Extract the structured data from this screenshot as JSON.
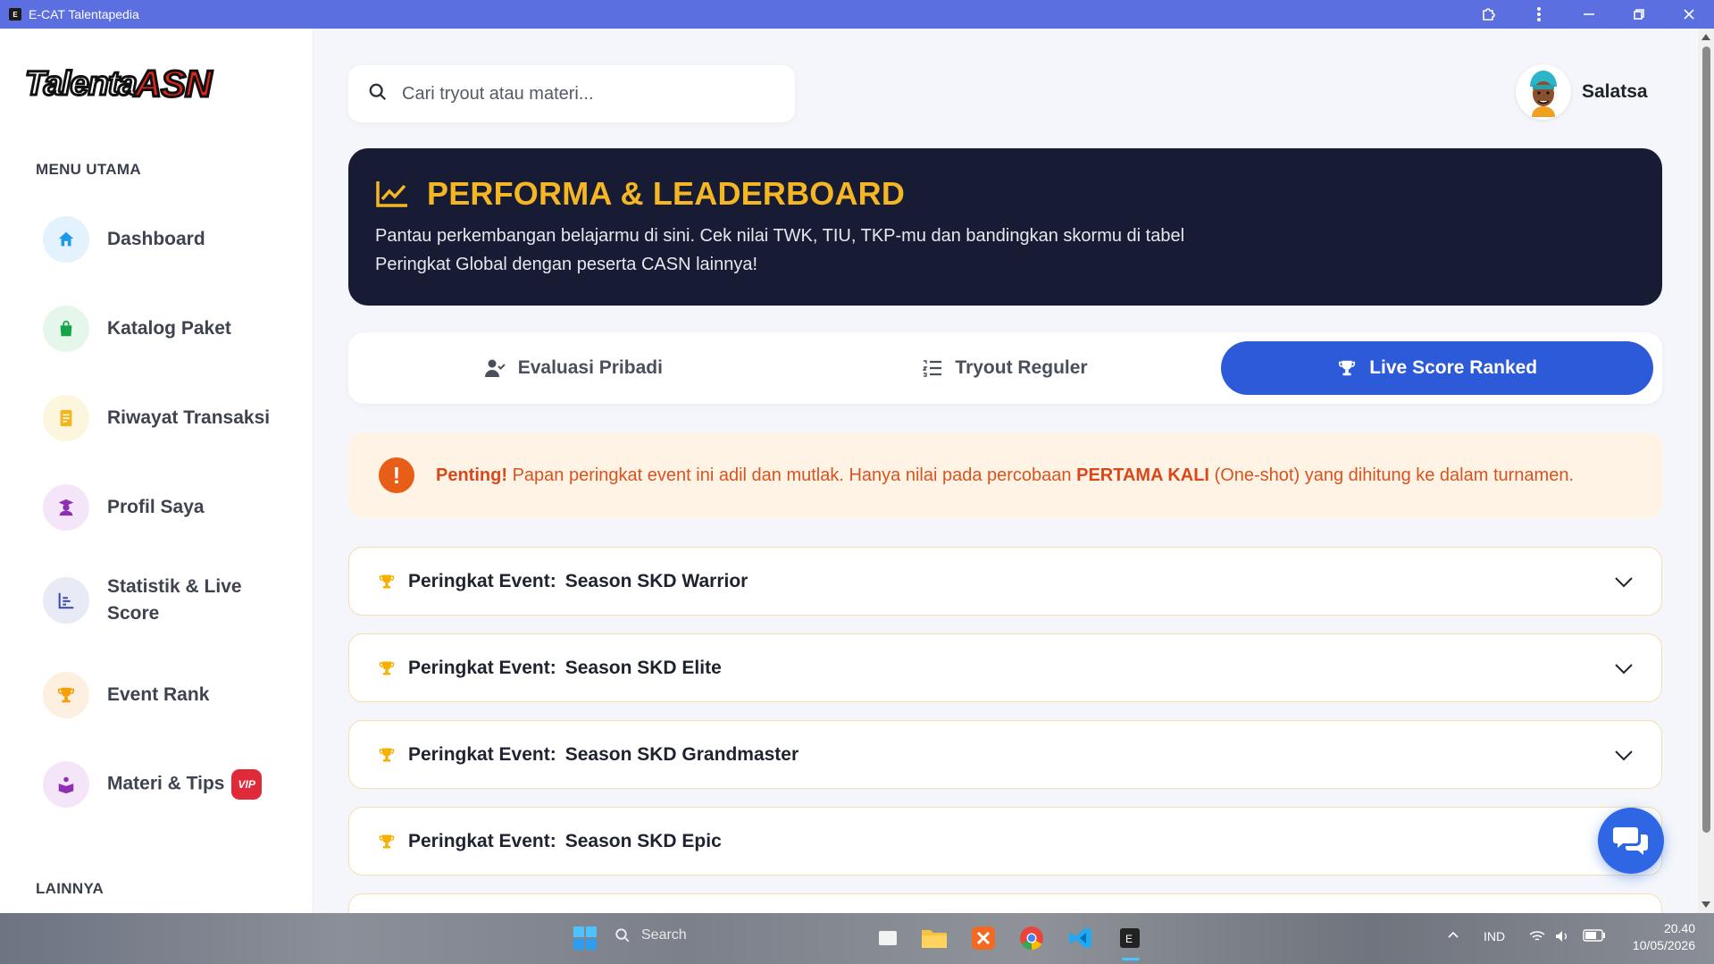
{
  "window": {
    "title": "E-CAT Talentapedia",
    "app_icon": "E"
  },
  "sidebar": {
    "logo_part1": "Talenta",
    "logo_part2": "ASN",
    "section_main": "MENU UTAMA",
    "section_other": "LAINNYA",
    "items": [
      {
        "label": "Dashboard",
        "icon": "home-icon",
        "color": "#1e9be8",
        "bg": "#e3f2fd"
      },
      {
        "label": "Katalog Paket",
        "icon": "shopping-bag-icon",
        "color": "#17a34a",
        "bg": "#e5f6ea"
      },
      {
        "label": "Riwayat Transaksi",
        "icon": "receipt-icon",
        "color": "#f2b619",
        "bg": "#fdf6df"
      },
      {
        "label": "Profil Saya",
        "icon": "user-graduate-icon",
        "color": "#8e2fb5",
        "bg": "#f4e6f8"
      },
      {
        "label": "Statistik & Live Score",
        "icon": "chart-icon",
        "color": "#3949ab",
        "bg": "#e8eaf6"
      },
      {
        "label": "Event Rank",
        "icon": "trophy-icon",
        "color": "#f59e0b",
        "bg": "#fdf0e0"
      },
      {
        "label": "Materi & Tips",
        "icon": "book-reader-icon",
        "color": "#8e2fb5",
        "bg": "#f4e6f8",
        "badge": "VIP"
      }
    ]
  },
  "search": {
    "placeholder": "Cari tryout atau materi..."
  },
  "user": {
    "name": "Salatsa"
  },
  "hero": {
    "title": "PERFORMA & LEADERBOARD",
    "description": "Pantau perkembangan belajarmu di sini. Cek nilai TWK, TIU, TKP-mu dan bandingkan skormu di tabel Peringkat Global dengan peserta CASN lainnya!"
  },
  "tabs": [
    {
      "label": "Evaluasi Pribadi",
      "active": false
    },
    {
      "label": "Tryout Reguler",
      "active": false
    },
    {
      "label": "Live Score Ranked",
      "active": true
    }
  ],
  "alert": {
    "icon": "!",
    "lead": "Penting!",
    "text1": "Papan peringkat event ini adil dan mutlak. Hanya nilai pada percobaan",
    "emphasis": "PERTAMA KALI",
    "text2": "(One-shot) yang dihitung ke dalam turnamen."
  },
  "events": {
    "prefix": "Peringkat Event:",
    "items": [
      {
        "name": "Season SKD Warrior"
      },
      {
        "name": "Season SKD Elite"
      },
      {
        "name": "Season SKD Grandmaster"
      },
      {
        "name": "Season SKD Epic"
      }
    ]
  },
  "taskbar": {
    "search_label": "Search",
    "language": "IND",
    "time": "20.40",
    "date": "10/05/2026"
  },
  "colors": {
    "accent": "#2d5ad8",
    "hero_bg": "#171c34",
    "hero_title": "#f5b623",
    "alert_text": "#d9531e",
    "titlebar": "#5b6fe0"
  }
}
